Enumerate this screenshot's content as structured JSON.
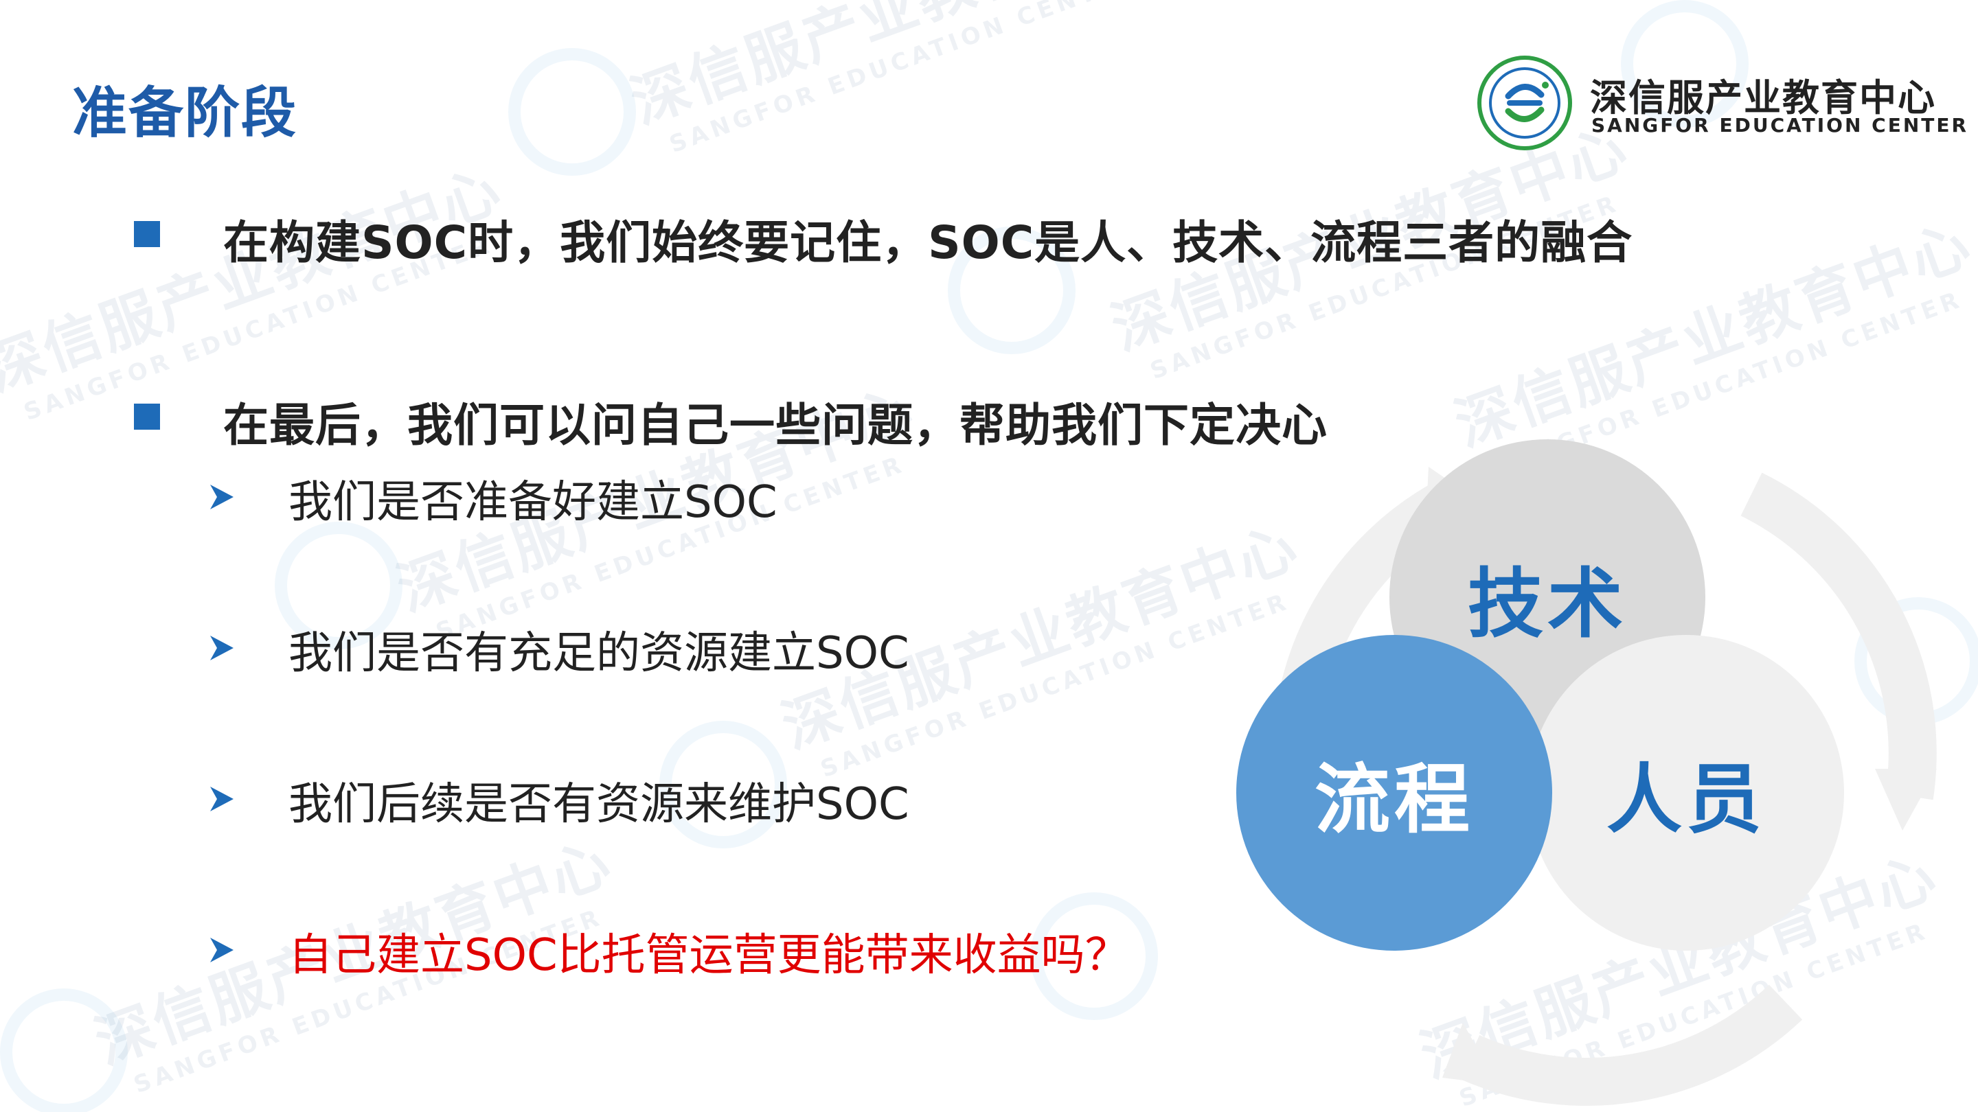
{
  "title": "准备阶段",
  "logo": {
    "name_cn": "深信服产业教育中心",
    "name_en": "SANGFOR EDUCATION CENTER",
    "seal_text": "SANGFOR EDUCATION CENTER 深信服产业教育中心"
  },
  "watermark": {
    "cn": "深信服产业教育中心",
    "en": "SANGFOR EDUCATION CENTER"
  },
  "bullets": [
    "在构建SOC时，我们始终要记住，SOC是人、技术、流程三者的融合",
    "在最后，我们可以问自己一些问题，帮助我们下定决心"
  ],
  "questions": [
    "我们是否准备好建立SOC",
    "我们是否有充足的资源建立SOC",
    "我们后续是否有资源来维护SOC",
    "自己建立SOC比托管运营更能带来收益吗？"
  ],
  "diagram": {
    "tech": "技术",
    "process": "流程",
    "people": "人员"
  },
  "colors": {
    "title": "#1e5ba8",
    "bullet": "#1e6bb8",
    "highlight": "#e00000",
    "process_circle": "#5b9bd5",
    "tech_circle": "#dadada",
    "people_circle": "#f0f0f0"
  }
}
